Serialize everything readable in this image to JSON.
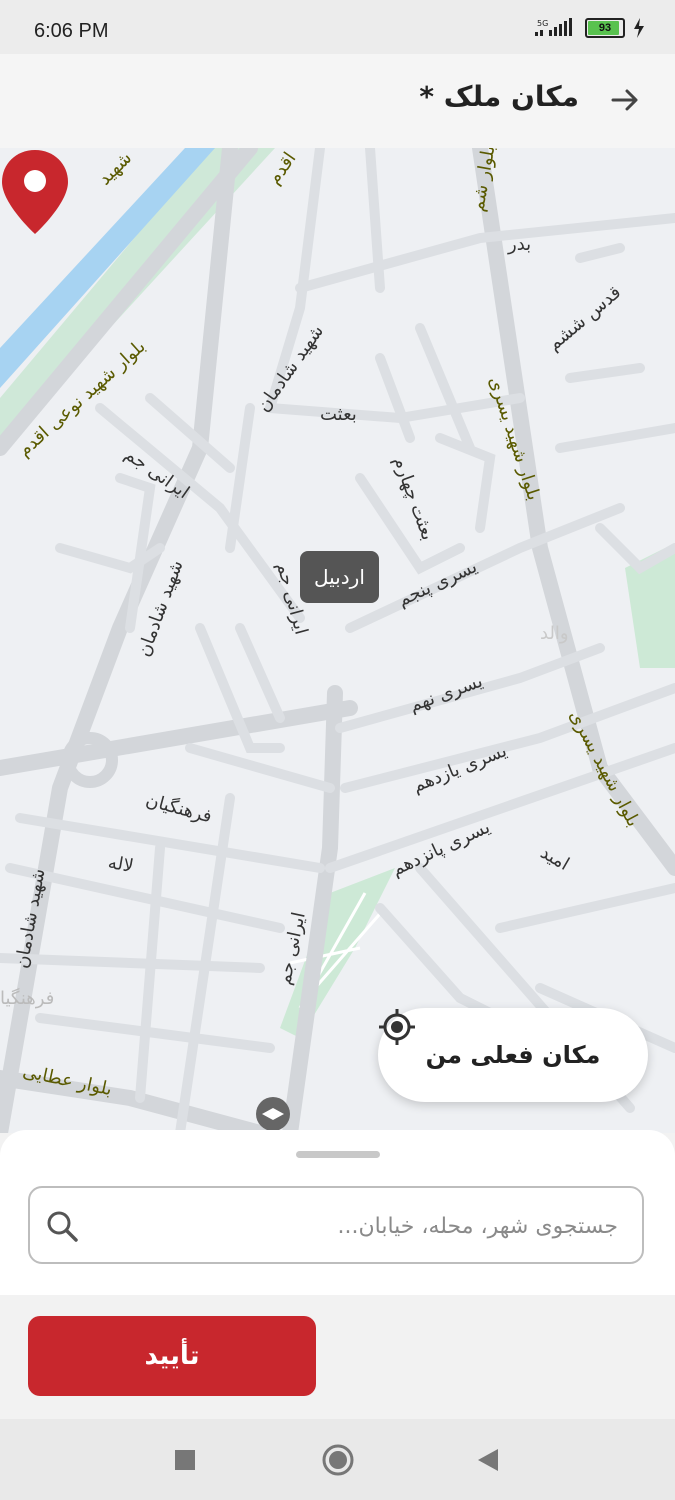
{
  "status_bar": {
    "time": "6:06 PM",
    "network": "5G",
    "battery": "93"
  },
  "header": {
    "title": "مکان ملک *"
  },
  "map": {
    "city_tooltip": "اردبیل",
    "labels": [
      "شهید",
      "اقدم",
      "بلوار شم",
      "بدر",
      "قدس ششم",
      "شهید شادمان",
      "بعثت",
      "بلوار شهید نوعی اقدم",
      "ایرانی جم",
      "بعثت چهارم",
      "بلوار شهید یسری",
      "شهید شادمان",
      "یسری پنجم",
      "ایرانی جم",
      "یسری نهم",
      "یسری یازدهم",
      "فرهنگیان",
      "یسری پانزدهم",
      "امید",
      "لاله",
      "شهید شادمان",
      "ایرانی جم",
      "بلوار شهید یسری",
      "بلوار عطایی",
      "فرهنگیا",
      "والد"
    ]
  },
  "locate_button": {
    "label": "مکان فعلی من"
  },
  "search": {
    "placeholder": "جستجوی شهر، محله، خیابان..."
  },
  "confirm_button": {
    "label": "تأیید"
  }
}
